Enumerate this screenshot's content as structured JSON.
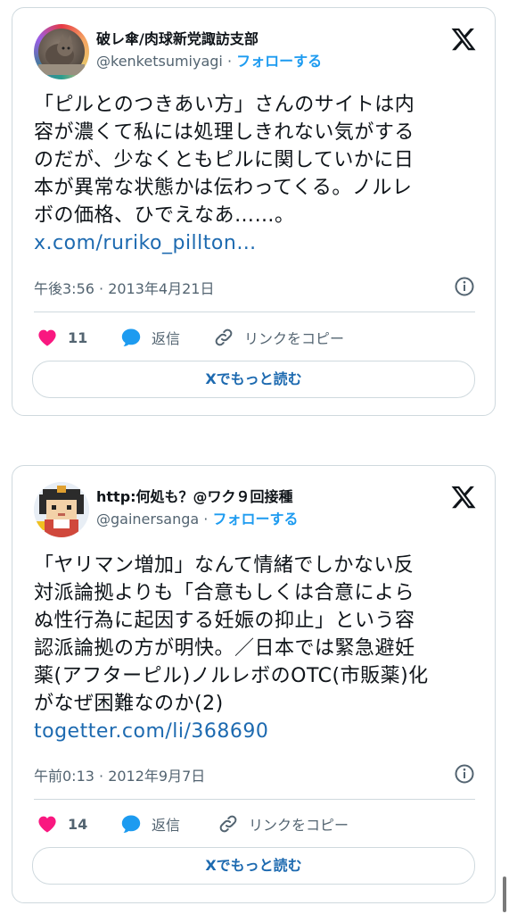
{
  "tweets": [
    {
      "display_name": "破レ傘/肉球新党諏訪支部",
      "handle": "@kenketsumiyagi",
      "separator": " · ",
      "follow_label": "フォローする",
      "lines": [
        "「ピルとのつきあい方」さんのサイトは内",
        "容が濃くて私には処理しきれない気がする",
        "のだが、少なくともピルに関していかに日",
        "本が異常な状態かは伝わってくる。ノルレ",
        "ボの価格、ひでえなあ……。"
      ],
      "link": "x.com/ruriko_pillton…",
      "timestamp": "午後3:56 · 2013年4月21日",
      "likes": "11",
      "reply_label": "返信",
      "copy_label": "リンクをコピー",
      "more_label": "Xでもっと読む"
    },
    {
      "display_name": "http:何処も？@ワク９回接種",
      "handle": "@gainersanga",
      "separator": " · ",
      "follow_label": "フォローする",
      "lines": [
        "「ヤリマン増加」なんて情緒でしかない反",
        "対派論拠よりも「合意もしくは合意によら",
        "ぬ性行為に起因する妊娠の抑止」という容",
        "認派論拠の方が明快。／日本では緊急避妊",
        "薬(アフターピル)ノルレボのOTC(市販薬)化",
        "がなぜ困難なのか(2)"
      ],
      "link": "togetter.com/li/368690",
      "timestamp": "午前0:13 · 2012年9月7日",
      "likes": "14",
      "reply_label": "返信",
      "copy_label": "リンクをコピー",
      "more_label": "Xでもっと読む"
    }
  ],
  "icons": {
    "x_logo": "x-logo-icon",
    "heart": "heart-icon",
    "reply": "reply-bubble-icon",
    "link": "link-icon",
    "info": "info-icon"
  },
  "colors": {
    "accent": "#1d9bf0",
    "link": "#1d6ab0",
    "heart": "#f91880",
    "muted": "#536471",
    "border": "#cfd9de"
  }
}
